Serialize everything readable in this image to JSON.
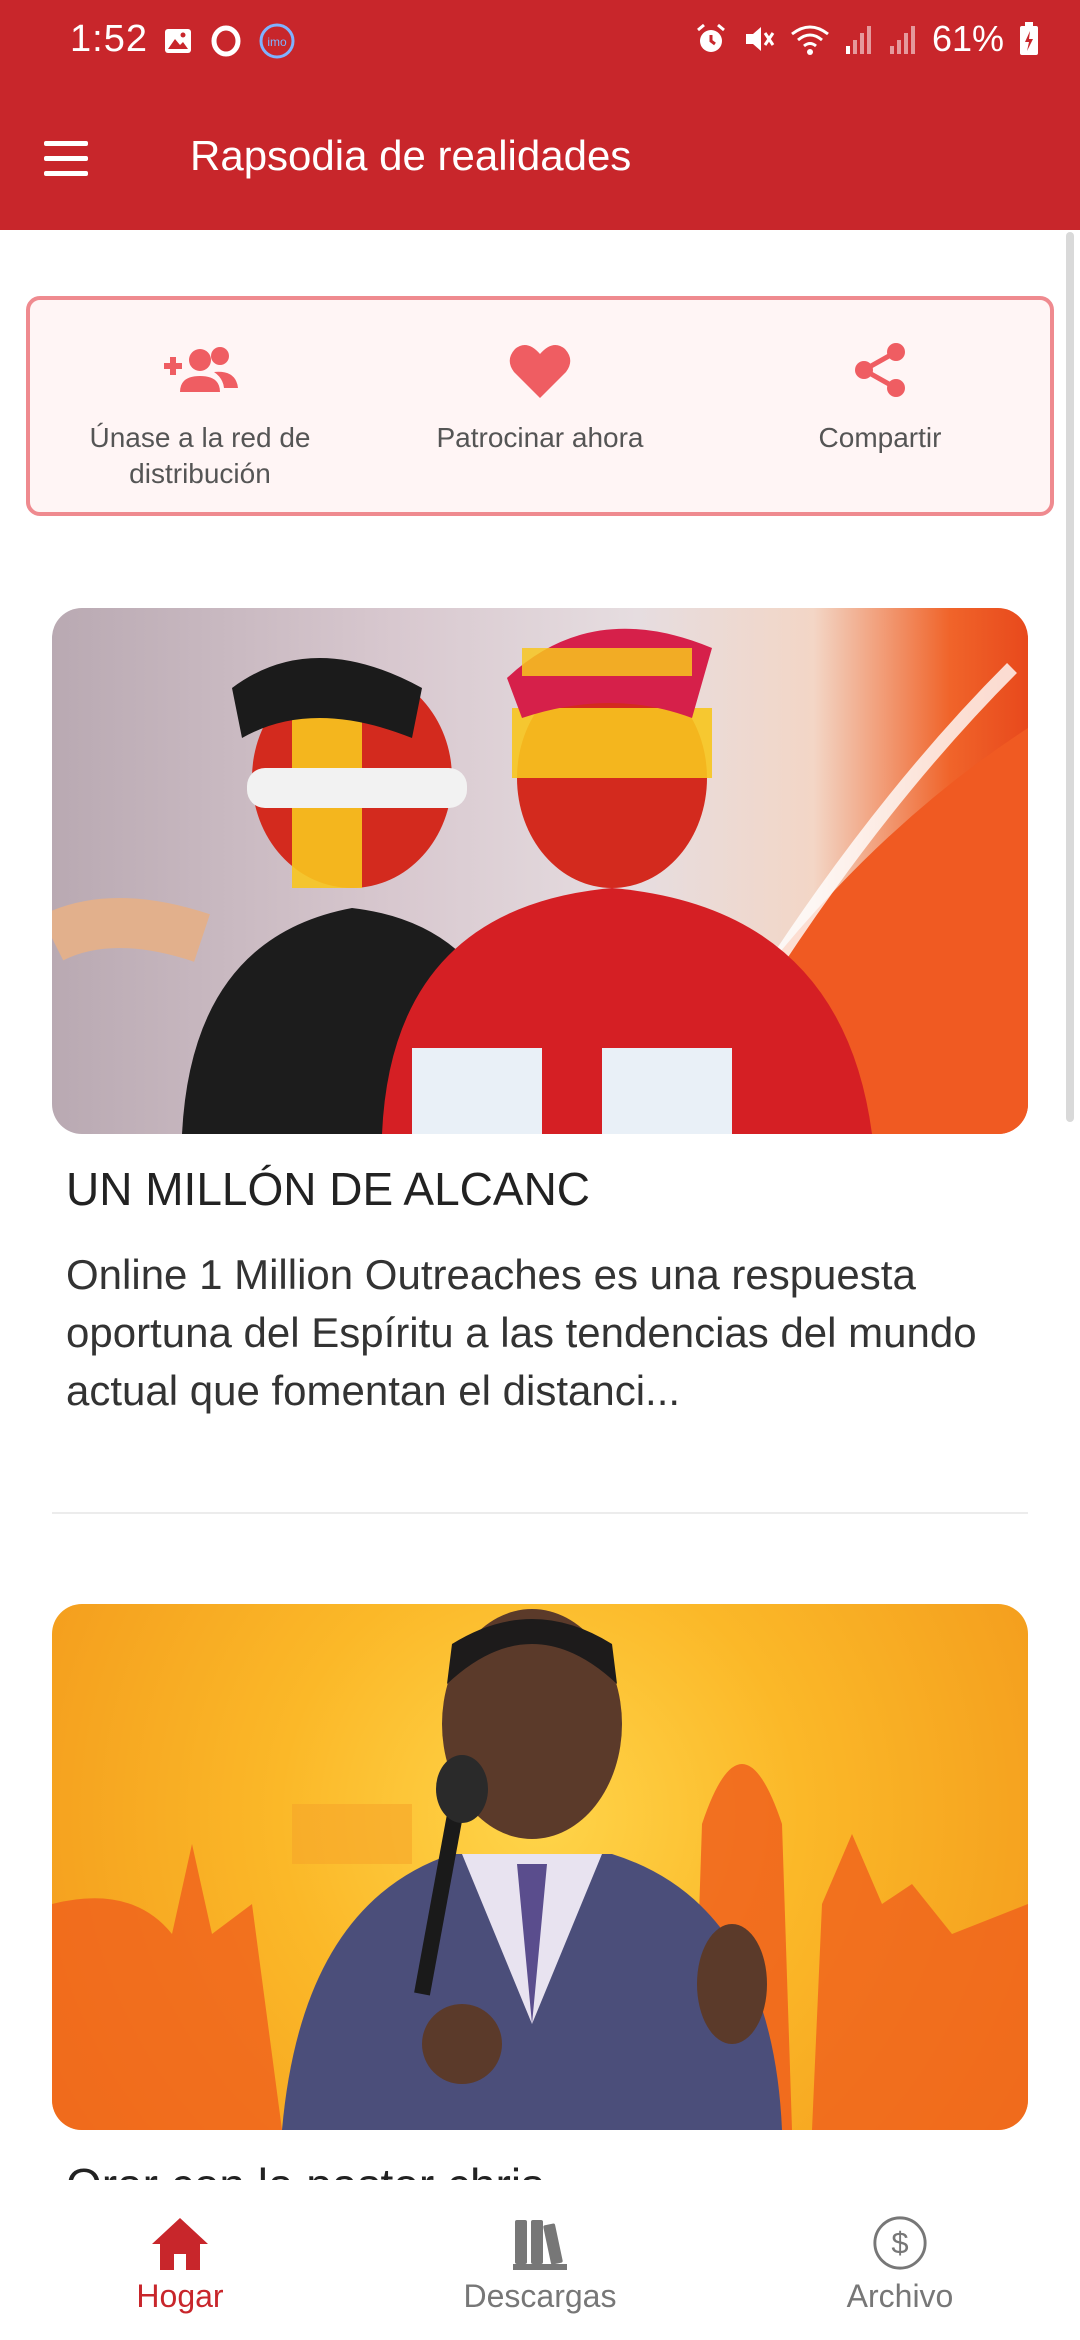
{
  "status_bar": {
    "time": "1:52",
    "battery": "61%",
    "left_icons": [
      "image-icon",
      "opera-icon",
      "imo-icon"
    ],
    "right_icons": [
      "alarm-icon",
      "mute-icon",
      "wifi-icon",
      "signal-icon",
      "signal-icon-2",
      "battery-icon"
    ],
    "imo_label": "imo"
  },
  "app_bar": {
    "title": "Rapsodia de realidades",
    "color": "#c8262b"
  },
  "actions": [
    {
      "label": "Únase a la red de distribución",
      "icon": "add-group-icon"
    },
    {
      "label": "Patrocinar ahora",
      "icon": "heart-icon"
    },
    {
      "label": "Compartir",
      "icon": "share-icon"
    }
  ],
  "articles": [
    {
      "title": "UN MILLÓN DE ALCANC",
      "excerpt": "Online 1 Million Outreaches es una respuesta oportuna del Espíritu a las tendencias del mundo actual que fomentan el distanci...",
      "image_description_icon": "photo-icon"
    },
    {
      "title": "Orar con la pastor chris",
      "image_description_icon": "photo-icon"
    }
  ],
  "bottom_nav": [
    {
      "label": "Hogar",
      "icon": "home-icon",
      "active": true
    },
    {
      "label": "Descargas",
      "icon": "library-icon",
      "active": false
    },
    {
      "label": "Archivo",
      "icon": "dollar-circle-icon",
      "active": false
    }
  ],
  "colors": {
    "primary": "#c8262b",
    "accent": "#ef5d62",
    "card_border": "#ef8a8f",
    "card_bg": "#fff5f5"
  }
}
